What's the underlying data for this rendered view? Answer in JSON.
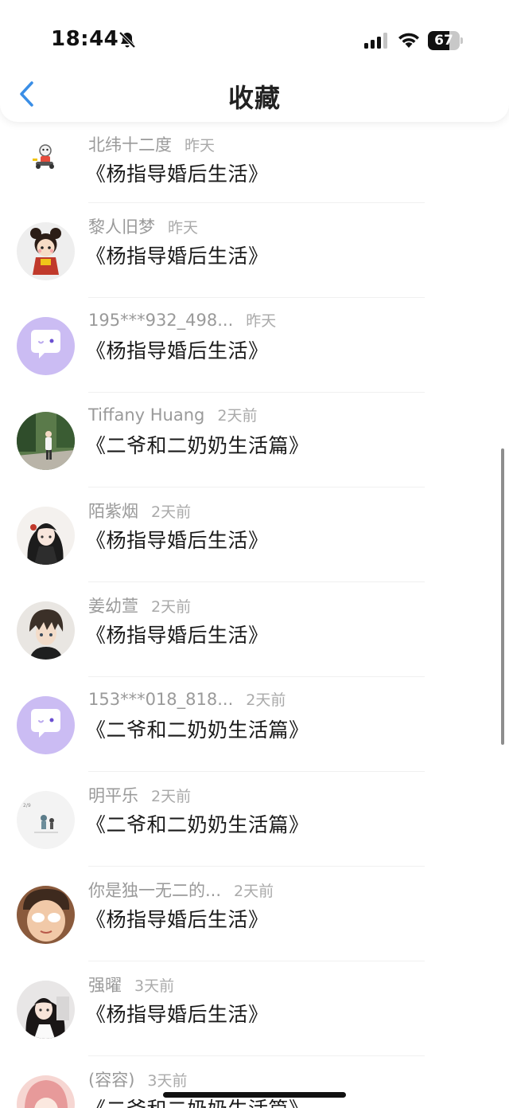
{
  "status_bar": {
    "time": "18:44",
    "battery": "67",
    "battery_level": 0.67
  },
  "header": {
    "title": "收藏"
  },
  "colors": {
    "back_icon": "#3a8ee6",
    "avatar_chat_bg": "#cbbcf3",
    "name_text": "#9a9a9a",
    "divider": "#f0f0f0"
  },
  "favorites": [
    {
      "name": "北纬十二度",
      "time": "昨天",
      "work": "《杨指导婚后生活》",
      "avatar": "robot-sticker-avatar"
    },
    {
      "name": "黎人旧梦",
      "time": "昨天",
      "work": "《杨指导婚后生活》",
      "avatar": "doll-girl-avatar"
    },
    {
      "name": "195***932_498...",
      "time": "昨天",
      "work": "《杨指导婚后生活》",
      "avatar": "default-chat-avatar"
    },
    {
      "name": "Tiffany Huang",
      "time": "2天前",
      "work": "《二爷和二奶奶生活篇》",
      "avatar": "outdoor-photo-avatar"
    },
    {
      "name": "陌紫烟",
      "time": "2天前",
      "work": "《杨指导婚后生活》",
      "avatar": "anime-girl-avatar"
    },
    {
      "name": "姜幼萱",
      "time": "2天前",
      "work": "《杨指导婚后生活》",
      "avatar": "anime-boy-avatar"
    },
    {
      "name": "153***018_818...",
      "time": "2天前",
      "work": "《二爷和二奶奶生活篇》",
      "avatar": "default-chat-avatar"
    },
    {
      "name": "明平乐",
      "time": "2天前",
      "work": "《二爷和二奶奶生活篇》",
      "avatar": "sketch-avatar"
    },
    {
      "name": "你是独一无二的...",
      "time": "2天前",
      "work": "《杨指导婚后生活》",
      "avatar": "face-photo-avatar"
    },
    {
      "name": "强曜",
      "time": "3天前",
      "work": "《杨指导婚后生活》",
      "avatar": "girl-photo-avatar"
    },
    {
      "name": "(容容)",
      "time": "3天前",
      "work": "《二爷和二奶奶生活篇》",
      "avatar": "pink-hair-avatar"
    }
  ]
}
